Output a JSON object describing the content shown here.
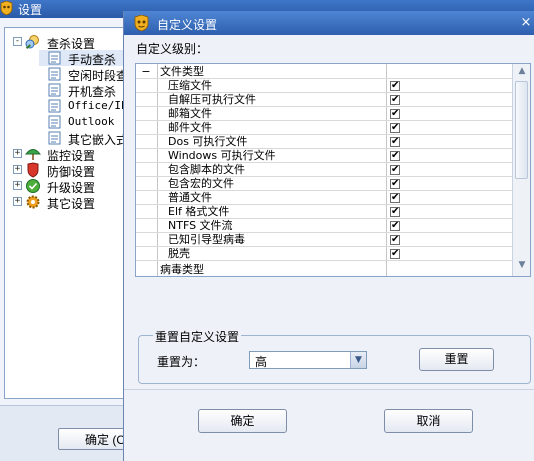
{
  "main_window": {
    "title": "设置",
    "ok_button_label": "确定 (O)"
  },
  "tree": {
    "items": [
      {
        "label": "查杀设置",
        "level": 0,
        "expander": "-",
        "icon": "search-shield-icon"
      },
      {
        "label": "手动查杀",
        "level": 1,
        "icon": "document-icon",
        "selected": true
      },
      {
        "label": "空闲时段查",
        "level": 1,
        "icon": "document-icon"
      },
      {
        "label": "开机查杀",
        "level": 1,
        "icon": "document-icon"
      },
      {
        "label": "Office/IE",
        "level": 1,
        "icon": "document-icon"
      },
      {
        "label": "Outlook",
        "level": 1,
        "icon": "document-icon"
      },
      {
        "label": "其它嵌入式",
        "level": 1,
        "icon": "document-icon"
      },
      {
        "label": "监控设置",
        "level": 0,
        "expander": "+",
        "icon": "umbrella-icon"
      },
      {
        "label": "防御设置",
        "level": 0,
        "expander": "+",
        "icon": "shield-icon"
      },
      {
        "label": "升级设置",
        "level": 0,
        "expander": "+",
        "icon": "update-icon"
      },
      {
        "label": "其它设置",
        "level": 0,
        "expander": "+",
        "icon": "gear-icon"
      }
    ]
  },
  "dialog": {
    "title": "自定义设置",
    "close_glyph": "×",
    "level_label": "自定义级别：",
    "grid": {
      "group_expander": "−",
      "group_label": "文件类型",
      "rows": [
        {
          "label": "压缩文件",
          "checked": true
        },
        {
          "label": "自解压可执行文件",
          "checked": true
        },
        {
          "label": "邮箱文件",
          "checked": true
        },
        {
          "label": "邮件文件",
          "checked": true
        },
        {
          "label": "Dos 可执行文件",
          "checked": true
        },
        {
          "label": "Windows 可执行文件",
          "checked": true
        },
        {
          "label": "包含脚本的文件",
          "checked": true
        },
        {
          "label": "包含宏的文件",
          "checked": true
        },
        {
          "label": "普通文件",
          "checked": true
        },
        {
          "label": "Elf 格式文件",
          "checked": true
        },
        {
          "label": "NTFS 文件流",
          "checked": true
        },
        {
          "label": "已知引导型病毒",
          "checked": true
        },
        {
          "label": "脱壳",
          "checked": true
        }
      ],
      "next_group_label": "病毒类型",
      "check_glyph": "✔",
      "scroll_up_glyph": "▲",
      "scroll_down_glyph": "▼"
    },
    "reset_group": {
      "legend": "重置自定义设置",
      "reset_to_label": "重置为：",
      "reset_to_value": "高",
      "dropdown_glyph": "▼",
      "reset_button_label": "重置"
    },
    "ok_button_label": "确定",
    "cancel_button_label": "取消"
  }
}
